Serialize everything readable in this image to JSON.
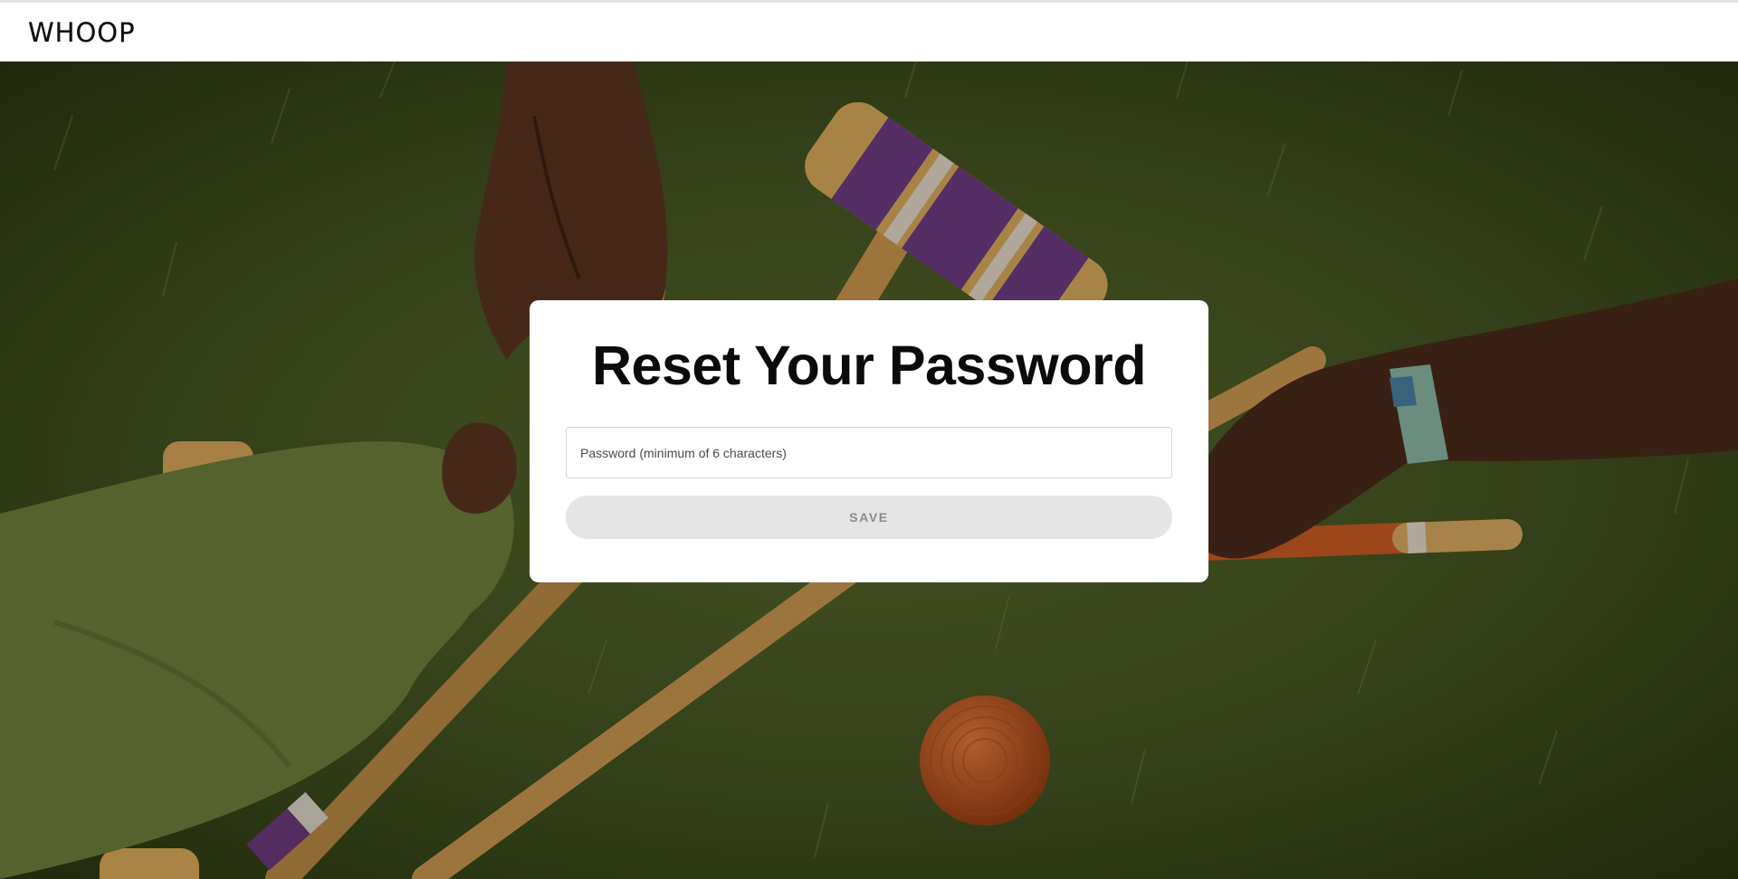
{
  "header": {
    "logo_text": "WHOOP"
  },
  "reset_card": {
    "title": "Reset Your Password",
    "password_placeholder": "Password (minimum of 6 characters)",
    "password_value": "",
    "save_label": "SAVE"
  },
  "colors": {
    "button_bg": "#e5e5e5",
    "button_text": "#8c8c8c",
    "card_bg": "#ffffff",
    "hero_grass": "#3c4a1f"
  },
  "hero": {
    "image_icon": "croquet-background-image"
  }
}
